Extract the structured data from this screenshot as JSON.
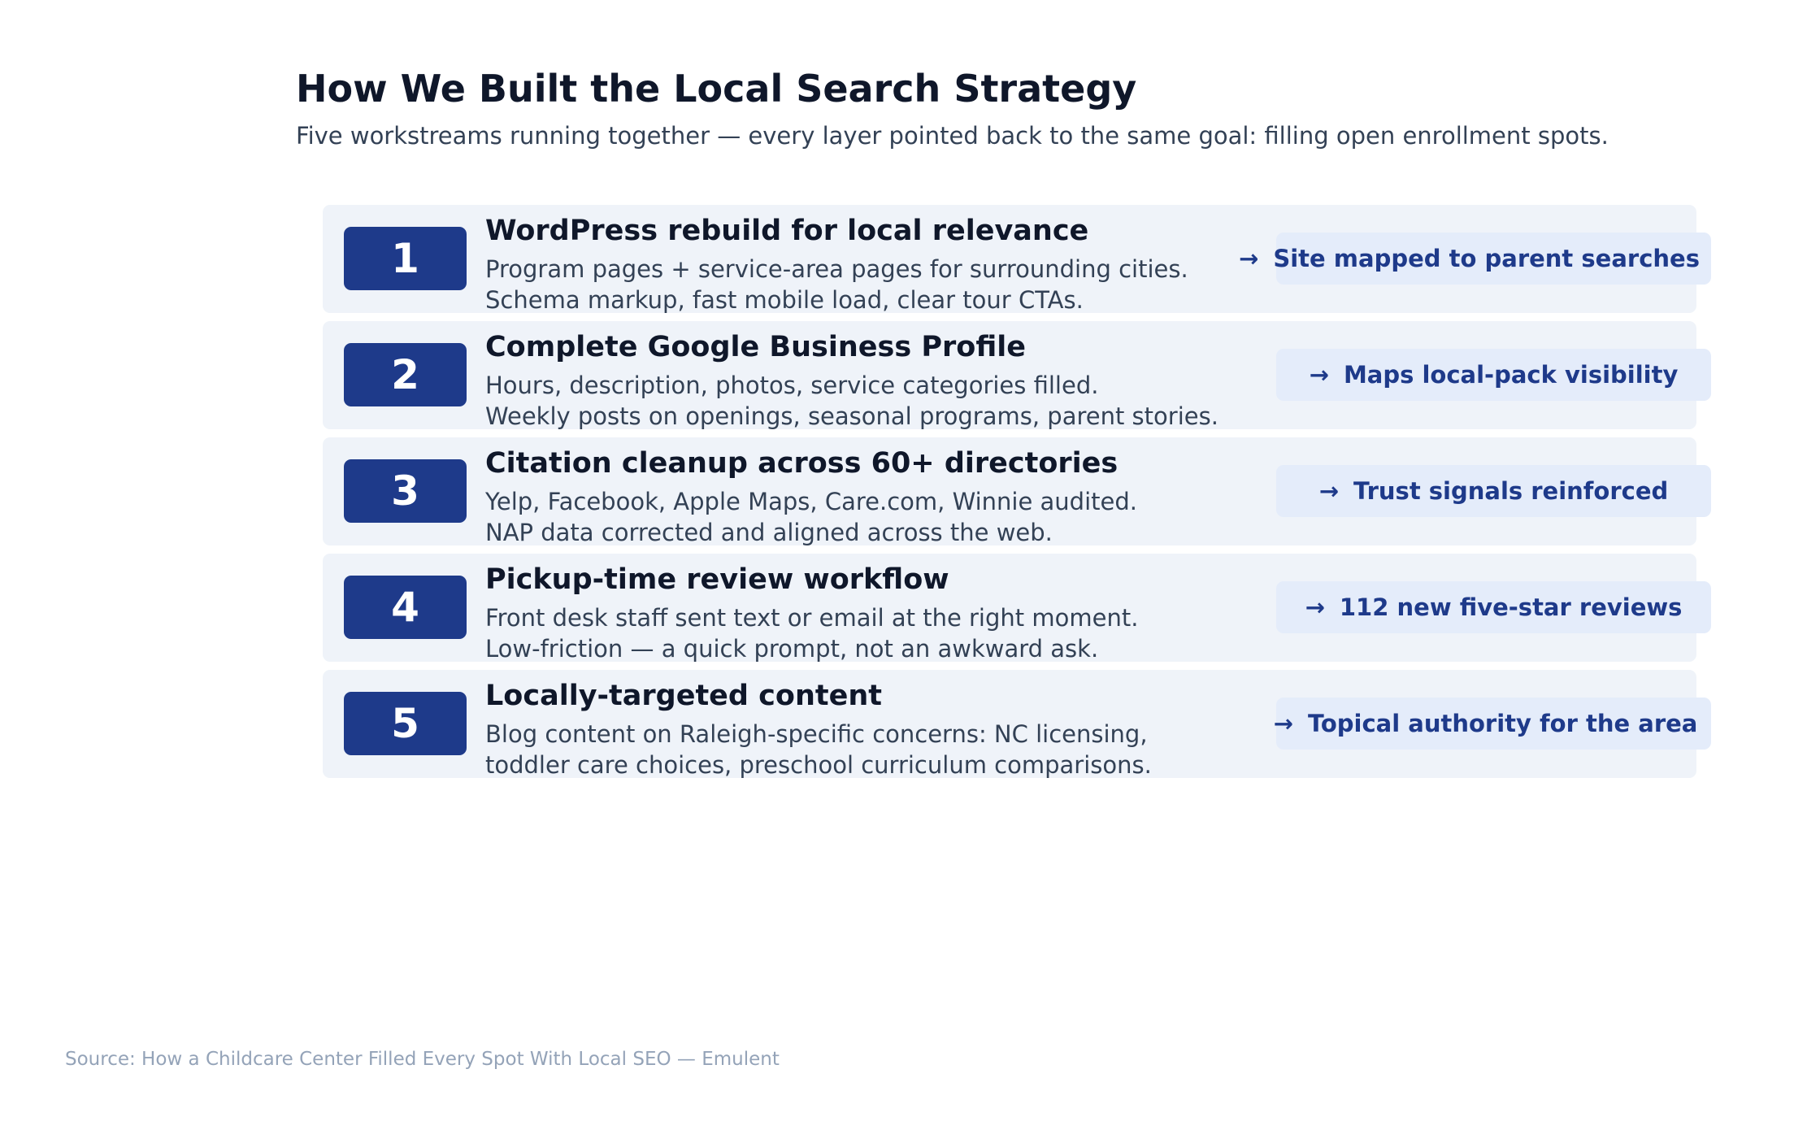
{
  "header": {
    "title": "How We Built the Local Search Strategy",
    "subtitle": "Five workstreams running together — every layer pointed back to the same goal: filling open enrollment spots."
  },
  "steps": [
    {
      "number": "1",
      "title": "WordPress rebuild for local relevance",
      "line1": "Program pages + service-area pages for surrounding cities.",
      "line2": "Schema markup, fast mobile load, clear tour CTAs.",
      "arrow": "→",
      "outcome": "Site mapped to parent searches"
    },
    {
      "number": "2",
      "title": "Complete Google Business Profile",
      "line1": "Hours, description, photos, service categories filled.",
      "line2": "Weekly posts on openings, seasonal programs, parent stories.",
      "arrow": "→",
      "outcome": "Maps local-pack visibility"
    },
    {
      "number": "3",
      "title": "Citation cleanup across 60+ directories",
      "line1": "Yelp, Facebook, Apple Maps, Care.com, Winnie audited.",
      "line2": "NAP data corrected and aligned across the web.",
      "arrow": "→",
      "outcome": "Trust signals reinforced"
    },
    {
      "number": "4",
      "title": "Pickup-time review workflow",
      "line1": "Front desk staff sent text or email at the right moment.",
      "line2": "Low-friction — a quick prompt, not an awkward ask.",
      "arrow": "→",
      "outcome": "112 new five-star reviews"
    },
    {
      "number": "5",
      "title": "Locally-targeted content",
      "line1": "Blog content on Raleigh-specific concerns: NC licensing,",
      "line2": "toddler care choices, preschool curriculum comparisons.",
      "arrow": "→",
      "outcome": "Topical authority for the area"
    }
  ],
  "footer": {
    "source": "Source: How a Childcare Center Filled Every Spot With Local SEO — Emulent"
  },
  "colors": {
    "badge": "#1e3a8a",
    "row_background": "#eff3f9",
    "outcome_background": "#e4ecfa",
    "outcome_text": "#1e3a8a"
  }
}
